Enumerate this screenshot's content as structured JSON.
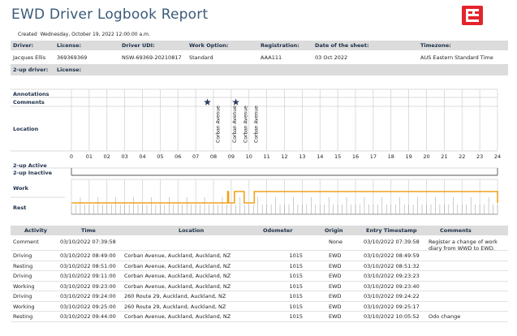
{
  "report": {
    "title": "EWD Driver Logbook Report",
    "created_label": "Created",
    "created_value": "Wednesday, October 19, 2022 12:00:00 a.m."
  },
  "driver_header": {
    "driver_label": "Driver:",
    "license_label": "License:",
    "udi_label": "Driver UDI:",
    "work_option_label": "Work Option:",
    "registration_label": "Registration:",
    "sheet_date_label": "Date of the sheet:",
    "timezone_label": "Timezone:"
  },
  "driver_values": {
    "driver": "Jacques Ellis",
    "license": "369369369",
    "udi": "NSW-69369-20210817",
    "work_option": "Standard",
    "registration": "AAA111",
    "sheet_date": "03 Oct 2022",
    "timezone": "AUS Eastern Standard Time"
  },
  "two_up_header": {
    "driver_label": "2-up driver:",
    "license_label": "License:"
  },
  "graph": {
    "row_labels": {
      "annotations": "Annotations",
      "comments": "Comments",
      "location": "Location",
      "two_up_active": "2-up Active",
      "two_up_inactive": "2-up Inactive",
      "work": "Work",
      "rest": "Rest"
    },
    "hour_labels": [
      "0",
      "01",
      "02",
      "03",
      "04",
      "05",
      "06",
      "07",
      "08",
      "09",
      "10",
      "11",
      "12",
      "13",
      "14",
      "15",
      "16",
      "17",
      "18",
      "19",
      "20",
      "21",
      "22",
      "23",
      "24"
    ],
    "comment_star_hours": [
      7.66,
      9.26
    ],
    "location_labels": [
      {
        "hour": 8.25,
        "text": "Corban Avenue"
      },
      {
        "hour": 9.18,
        "text": "Corban Avenue"
      },
      {
        "hour": 9.8,
        "text": "Corban Avenue"
      },
      {
        "hour": 10.4,
        "text": "Corban Avenue"
      }
    ],
    "status_line_color": "#f0a21a",
    "status_segments": [
      {
        "from_hour": 0,
        "to_hour": 8.8,
        "status": "rest"
      },
      {
        "from_hour": 8.8,
        "to_hour": 8.85,
        "status": "work"
      },
      {
        "from_hour": 8.85,
        "to_hour": 9.18,
        "status": "rest"
      },
      {
        "from_hour": 9.18,
        "to_hour": 9.4,
        "status": "work"
      },
      {
        "from_hour": 9.4,
        "to_hour": 9.42,
        "status": "work"
      },
      {
        "from_hour": 9.42,
        "to_hour": 9.73,
        "status": "work"
      },
      {
        "from_hour": 9.73,
        "to_hour": 10.3,
        "status": "rest"
      },
      {
        "from_hour": 10.3,
        "to_hour": 24,
        "status": "work"
      }
    ]
  },
  "table": {
    "headers": {
      "activity": "Activity",
      "time": "Time",
      "location": "Location",
      "odometer": "Odometer",
      "origin": "Origin",
      "entry_timestamp": "Entry Timestamp",
      "comments": "Comments"
    },
    "rows": [
      {
        "activity": "Comment",
        "time": "03/10/2022 07:39:58",
        "location": "",
        "odometer": "",
        "origin": "None",
        "entry": "03/10/2022 07:39:58",
        "comments": "Register a change of work diary from WWD to EWD."
      },
      {
        "activity": "Driving",
        "time": "03/10/2022 08:49:00",
        "location": "Corban Avenue, Auckland, Auckland, NZ",
        "odometer": "1015",
        "origin": "EWD",
        "entry": "03/10/2022 08:49:59",
        "comments": ""
      },
      {
        "activity": "Resting",
        "time": "03/10/2022 08:51:00",
        "location": "Corban Avenue, Auckland, Auckland, NZ",
        "odometer": "1015",
        "origin": "EWD",
        "entry": "03/10/2022 08:51:32",
        "comments": ""
      },
      {
        "activity": "Driving",
        "time": "03/10/2022 09:11:00",
        "location": "Corban Avenue, Auckland, Auckland, NZ",
        "odometer": "1015",
        "origin": "EWD",
        "entry": "03/10/2022 09:23:23",
        "comments": ""
      },
      {
        "activity": "Working",
        "time": "03/10/2022 09:23:00",
        "location": "Corban Avenue, Auckland, Auckland, NZ",
        "odometer": "1015",
        "origin": "EWD",
        "entry": "03/10/2022 09:23:40",
        "comments": ""
      },
      {
        "activity": "Driving",
        "time": "03/10/2022 09:24:00",
        "location": "260 Route 29, Auckland, Auckland, NZ",
        "odometer": "1015",
        "origin": "EWD",
        "entry": "03/10/2022 09:24:22",
        "comments": ""
      },
      {
        "activity": "Working",
        "time": "03/10/2022 09:25:00",
        "location": "260 Route 29, Auckland, Auckland, NZ",
        "odometer": "1015",
        "origin": "EWD",
        "entry": "03/10/2022 09:25:17",
        "comments": ""
      },
      {
        "activity": "Resting",
        "time": "03/10/2022 09:44:00",
        "location": "Corban Avenue, Auckland, Auckland, NZ",
        "odometer": "1015",
        "origin": "EWD",
        "entry": "03/10/2022 10:05:52",
        "comments": "Odo change"
      }
    ]
  },
  "colors": {
    "title": "#3a5a78",
    "header_bg": "#dcdcdc",
    "brand": "#e4242b",
    "star": "#2f3e63"
  }
}
